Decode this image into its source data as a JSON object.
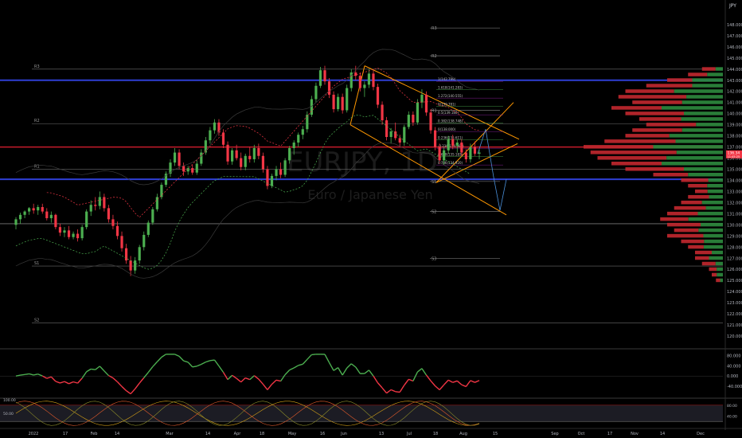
{
  "chart_data": {
    "type": "candlestick",
    "symbol": "EURJPY, 1D",
    "symbol_description": "Euro / Japanese Yen",
    "currency": "JPY",
    "price_axis": {
      "range": [
        119,
        150
      ],
      "ticks": [
        "148.000",
        "147.000",
        "146.000",
        "145.000",
        "144.000",
        "143.000",
        "142.000",
        "141.000",
        "140.000",
        "139.000",
        "138.000",
        "137.000",
        "136.000",
        "135.000",
        "134.000",
        "133.000",
        "132.000",
        "131.000",
        "130.000",
        "129.000",
        "128.000",
        "127.000",
        "126.000",
        "125.000",
        "124.000",
        "123.000",
        "122.000",
        "121.000",
        "120.000"
      ],
      "last_price_badge": [
        "136.34",
        "11:45:25"
      ]
    },
    "time_axis": {
      "labels": [
        "2022",
        "17",
        "Feb",
        "14",
        "Mar",
        "14",
        "Apr",
        "18",
        "May",
        "16",
        "Jun",
        "13",
        "Jul",
        "18",
        "Aug",
        "15",
        "Sep",
        "Oct",
        "17",
        "Nov",
        "14",
        "Dec",
        "19"
      ]
    },
    "candles": [
      [
        130.0,
        130.7,
        129.6,
        130.5
      ],
      [
        130.5,
        131.1,
        130.1,
        130.9
      ],
      [
        130.9,
        131.3,
        130.6,
        131.2
      ],
      [
        131.2,
        131.6,
        130.9,
        131.5
      ],
      [
        131.5,
        131.9,
        131.0,
        131.3
      ],
      [
        131.3,
        131.8,
        130.9,
        131.6
      ],
      [
        131.6,
        131.9,
        131.0,
        131.2
      ],
      [
        131.2,
        131.5,
        130.4,
        130.6
      ],
      [
        130.6,
        131.2,
        130.2,
        130.9
      ],
      [
        130.9,
        131.0,
        129.6,
        129.8
      ],
      [
        129.8,
        130.1,
        129.0,
        129.3
      ],
      [
        129.3,
        129.8,
        128.9,
        129.5
      ],
      [
        129.5,
        129.9,
        128.7,
        128.9
      ],
      [
        128.9,
        129.4,
        128.7,
        129.2
      ],
      [
        129.2,
        129.6,
        128.5,
        128.8
      ],
      [
        128.8,
        130.0,
        128.6,
        129.8
      ],
      [
        129.8,
        131.4,
        129.6,
        131.2
      ],
      [
        131.2,
        132.2,
        130.8,
        131.8
      ],
      [
        131.8,
        132.5,
        131.3,
        131.7
      ],
      [
        131.7,
        133.0,
        131.4,
        132.5
      ],
      [
        132.5,
        132.8,
        131.2,
        131.5
      ],
      [
        131.5,
        131.8,
        130.2,
        130.5
      ],
      [
        130.5,
        130.9,
        129.6,
        129.9
      ],
      [
        129.9,
        130.3,
        128.7,
        129.0
      ],
      [
        129.0,
        129.4,
        127.6,
        127.9
      ],
      [
        127.9,
        128.3,
        126.5,
        126.8
      ],
      [
        126.8,
        127.2,
        125.4,
        125.9
      ],
      [
        125.9,
        127.1,
        125.6,
        126.8
      ],
      [
        126.8,
        128.2,
        126.5,
        128.0
      ],
      [
        128.0,
        129.4,
        127.7,
        129.1
      ],
      [
        129.1,
        130.4,
        128.9,
        130.2
      ],
      [
        130.2,
        131.6,
        130.0,
        131.4
      ],
      [
        131.4,
        132.8,
        131.2,
        132.5
      ],
      [
        132.5,
        133.8,
        132.3,
        133.6
      ],
      [
        133.6,
        134.8,
        133.4,
        134.6
      ],
      [
        134.6,
        135.9,
        134.3,
        135.6
      ],
      [
        135.6,
        136.9,
        135.3,
        136.5
      ],
      [
        136.5,
        136.8,
        135.0,
        135.3
      ],
      [
        135.3,
        135.6,
        134.4,
        134.8
      ],
      [
        134.8,
        135.3,
        134.5,
        135.1
      ],
      [
        135.1,
        135.4,
        134.5,
        134.7
      ],
      [
        134.7,
        135.8,
        134.5,
        135.5
      ],
      [
        135.5,
        136.8,
        135.3,
        136.5
      ],
      [
        136.5,
        137.9,
        136.3,
        137.6
      ],
      [
        137.6,
        138.8,
        137.3,
        138.5
      ],
      [
        138.5,
        139.5,
        138.2,
        139.2
      ],
      [
        139.2,
        139.5,
        138.0,
        138.3
      ],
      [
        138.3,
        138.6,
        136.9,
        137.2
      ],
      [
        137.2,
        137.5,
        135.4,
        135.7
      ],
      [
        135.7,
        136.9,
        135.4,
        136.7
      ],
      [
        136.7,
        137.2,
        135.8,
        136.0
      ],
      [
        136.0,
        136.5,
        134.9,
        135.2
      ],
      [
        135.2,
        136.4,
        134.9,
        136.2
      ],
      [
        136.2,
        137.0,
        135.6,
        135.9
      ],
      [
        135.9,
        137.2,
        135.6,
        136.9
      ],
      [
        136.9,
        137.3,
        135.9,
        136.2
      ],
      [
        136.2,
        136.5,
        134.7,
        135.0
      ],
      [
        135.0,
        135.3,
        133.2,
        133.5
      ],
      [
        133.5,
        134.6,
        133.3,
        134.4
      ],
      [
        134.4,
        135.3,
        134.0,
        135.0
      ],
      [
        135.0,
        135.6,
        134.2,
        134.5
      ],
      [
        134.5,
        136.0,
        134.3,
        135.8
      ],
      [
        135.8,
        137.1,
        135.5,
        136.9
      ],
      [
        136.9,
        137.6,
        136.3,
        137.4
      ],
      [
        137.4,
        138.3,
        137.0,
        138.1
      ],
      [
        138.1,
        138.9,
        137.7,
        138.6
      ],
      [
        138.6,
        140.2,
        138.3,
        139.9
      ],
      [
        139.9,
        141.6,
        139.7,
        141.3
      ],
      [
        141.3,
        142.8,
        141.0,
        142.5
      ],
      [
        142.5,
        144.2,
        142.3,
        143.9
      ],
      [
        143.9,
        144.3,
        142.6,
        142.9
      ],
      [
        142.9,
        143.2,
        141.4,
        141.7
      ],
      [
        141.7,
        142.0,
        140.1,
        140.4
      ],
      [
        140.4,
        141.8,
        140.2,
        141.5
      ],
      [
        141.5,
        141.8,
        140.0,
        140.3
      ],
      [
        140.3,
        142.6,
        140.1,
        142.3
      ],
      [
        142.3,
        144.0,
        142.0,
        143.7
      ],
      [
        143.7,
        144.3,
        143.0,
        143.4
      ],
      [
        143.4,
        143.7,
        142.0,
        142.3
      ],
      [
        142.3,
        142.9,
        141.5,
        142.6
      ],
      [
        142.6,
        144.0,
        142.3,
        143.6
      ],
      [
        143.6,
        143.9,
        142.1,
        142.4
      ],
      [
        142.4,
        142.7,
        140.5,
        140.8
      ],
      [
        140.8,
        141.1,
        139.0,
        139.4
      ],
      [
        139.4,
        139.7,
        137.6,
        137.9
      ],
      [
        137.9,
        138.7,
        137.3,
        138.4
      ],
      [
        138.4,
        139.2,
        137.6,
        137.8
      ],
      [
        137.8,
        138.1,
        137.0,
        137.4
      ],
      [
        137.4,
        139.0,
        137.1,
        138.8
      ],
      [
        138.8,
        140.2,
        138.6,
        139.9
      ],
      [
        139.9,
        140.2,
        138.9,
        139.2
      ],
      [
        139.2,
        141.3,
        139.0,
        141.0
      ],
      [
        141.0,
        142.2,
        140.5,
        141.7
      ],
      [
        141.7,
        142.0,
        139.8,
        140.1
      ],
      [
        140.1,
        140.4,
        138.2,
        138.5
      ],
      [
        138.5,
        138.8,
        136.7,
        137.0
      ],
      [
        137.0,
        137.3,
        135.5,
        135.8
      ],
      [
        135.8,
        137.0,
        135.4,
        136.7
      ],
      [
        136.7,
        138.0,
        136.4,
        137.7
      ],
      [
        137.7,
        138.1,
        136.8,
        137.1
      ],
      [
        137.1,
        137.7,
        136.5,
        137.4
      ],
      [
        137.4,
        137.7,
        136.2,
        136.5
      ],
      [
        136.5,
        136.8,
        135.6,
        135.9
      ],
      [
        135.9,
        137.3,
        135.6,
        137.0
      ],
      [
        137.0,
        137.5,
        136.2,
        136.4
      ],
      [
        136.4,
        136.8,
        135.9,
        136.5
      ]
    ],
    "annotations": {
      "pivots_h1": [
        {
          "label": "R3",
          "value": 144.0
        },
        {
          "label": "R2",
          "value": 139.1
        },
        {
          "label": "R1",
          "value": 135.0
        },
        {
          "label": "S1",
          "value": 126.3
        },
        {
          "label": "S2",
          "value": 121.2
        }
      ],
      "pivots_h2": [
        {
          "label": "R3",
          "value": 147.7
        },
        {
          "label": "R2",
          "value": 145.2
        },
        {
          "label": "R1",
          "value": 140.3
        },
        {
          "label": "S1",
          "value": 133.9
        },
        {
          "label": "S2",
          "value": 131.2
        },
        {
          "label": "S3",
          "value": 127.0
        }
      ],
      "blue_lines": [
        143.0,
        134.1
      ],
      "red_line": 137.0,
      "gray_line": 130.1,
      "fib_labels": [
        "1(142.799)",
        "1.618(141.283)",
        "1.272(140.555)",
        "0(139.781)",
        "0.5(139.180)",
        "0.382(138.748)",
        "0(138.000)",
        "0.236(135.611)",
        "-0.236(134.567)",
        "0.618(135.183)",
        "0.786(134.920)"
      ],
      "volume_profile": [
        [
          144.0,
          0.15
        ],
        [
          143.5,
          0.25
        ],
        [
          143.0,
          0.4
        ],
        [
          142.5,
          0.55
        ],
        [
          142.0,
          0.7
        ],
        [
          141.5,
          0.75
        ],
        [
          141.0,
          0.65
        ],
        [
          140.5,
          0.8
        ],
        [
          140.0,
          0.7
        ],
        [
          139.5,
          0.6
        ],
        [
          139.0,
          0.55
        ],
        [
          138.5,
          0.65
        ],
        [
          138.0,
          0.7
        ],
        [
          137.5,
          0.85
        ],
        [
          137.0,
          1.0
        ],
        [
          136.5,
          0.95
        ],
        [
          136.0,
          0.9
        ],
        [
          135.5,
          0.8
        ],
        [
          135.0,
          0.7
        ],
        [
          134.5,
          0.5
        ],
        [
          134.0,
          0.3
        ],
        [
          133.5,
          0.25
        ],
        [
          133.0,
          0.2
        ],
        [
          132.5,
          0.25
        ],
        [
          132.0,
          0.3
        ],
        [
          131.5,
          0.35
        ],
        [
          131.0,
          0.4
        ],
        [
          130.5,
          0.45
        ],
        [
          130.0,
          0.4
        ],
        [
          129.5,
          0.35
        ],
        [
          129.0,
          0.4
        ],
        [
          128.5,
          0.3
        ],
        [
          128.0,
          0.25
        ],
        [
          127.5,
          0.2
        ],
        [
          127.0,
          0.2
        ],
        [
          126.5,
          0.15
        ],
        [
          126.0,
          0.1
        ],
        [
          125.5,
          0.08
        ],
        [
          125.0,
          0.05
        ]
      ]
    },
    "oscillator1": {
      "ticks": [
        "80.000",
        "40.000",
        "0.000",
        "-40.000"
      ],
      "range": [
        -80,
        100
      ]
    },
    "oscillator2": {
      "ticks": [
        "100.00",
        "50.00",
        "80.00",
        "40.00"
      ],
      "range": [
        0,
        100
      ]
    }
  },
  "colors": {
    "up": "#4caf50",
    "down": "#f23645",
    "blue_level": "#2f3fd4",
    "red_level": "#c51a2a",
    "channel": "#ff9800",
    "stop_up": "#4caf50",
    "stop_down": "#f23645"
  }
}
